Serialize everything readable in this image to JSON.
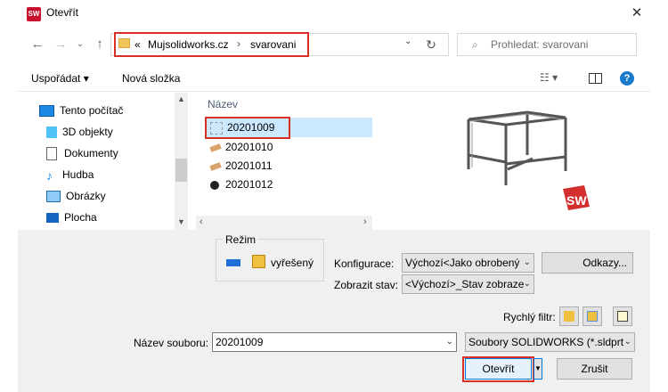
{
  "window": {
    "title": "Otevřít",
    "app_icon_text": "SW 2020"
  },
  "address": {
    "prefix": "«",
    "crumbs": [
      "Mujsolidworks.cz",
      "svarovani"
    ],
    "separator": "›"
  },
  "search": {
    "placeholder": "Prohledat: svarovani"
  },
  "toolbar": {
    "organize": "Uspořádat ▾",
    "new_folder": "Nová složka"
  },
  "sidebar": {
    "items": [
      {
        "label": "Tento počítač",
        "icon": "computer-icon"
      },
      {
        "label": "3D objekty",
        "icon": "cube-icon"
      },
      {
        "label": "Dokumenty",
        "icon": "document-icon"
      },
      {
        "label": "Hudba",
        "icon": "music-icon"
      },
      {
        "label": "Obrázky",
        "icon": "pictures-icon"
      },
      {
        "label": "Plocha",
        "icon": "desktop-icon"
      }
    ]
  },
  "files": {
    "column_header": "Název",
    "items": [
      {
        "name": "20201009",
        "selected": true
      },
      {
        "name": "20201010",
        "selected": false
      },
      {
        "name": "20201011",
        "selected": false
      },
      {
        "name": "20201012",
        "selected": false
      }
    ]
  },
  "options": {
    "mode_group": "Režim",
    "mode_value": "vyřešený",
    "config_label": "Konfigurace:",
    "config_value": "Výchozí<Jako obrobený",
    "display_label": "Zobrazit stav:",
    "display_value": "<Výchozí>_Stav zobraze",
    "references_button": "Odkazy...",
    "quick_filter_label": "Rychlý filtr:",
    "filename_label": "Název souboru:",
    "filename_value": "20201009",
    "filetype_value": "Soubory SOLIDWORKS (*.sldprt",
    "open_button": "Otevřít",
    "cancel_button": "Zrušit"
  },
  "colors": {
    "accent": "#0078d7",
    "highlight_red": "#d93025",
    "selection": "#cce8ff",
    "sw_red": "#c8102e"
  }
}
